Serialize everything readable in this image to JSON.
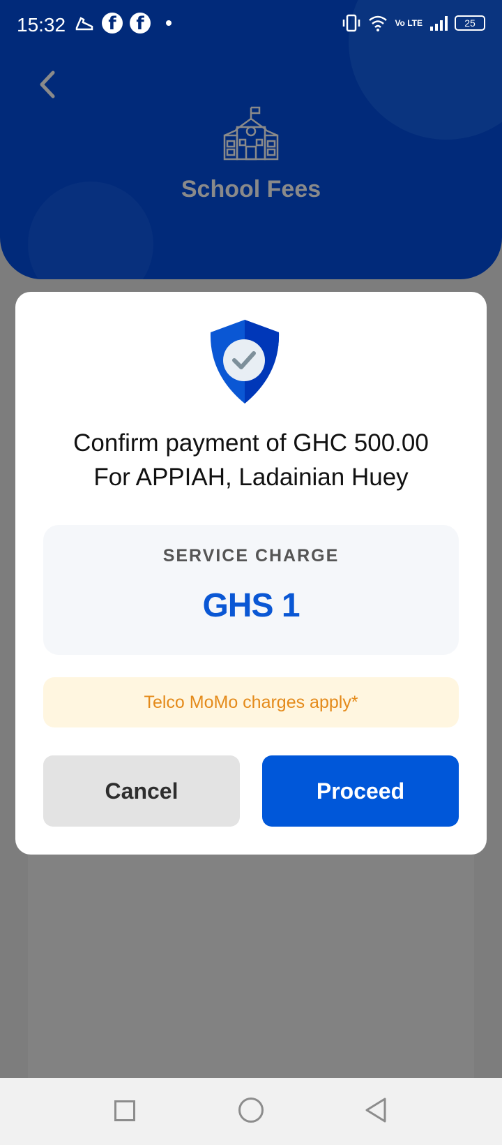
{
  "status_bar": {
    "time": "15:32",
    "battery": "25",
    "volte": "Vo LTE",
    "icons": [
      "shoe-icon",
      "facebook-icon",
      "facebook-icon",
      "dot-icon",
      "vibrate-icon",
      "wifi-icon",
      "signal-icon",
      "battery-icon"
    ]
  },
  "header": {
    "title": "School Fees",
    "icon": "school-icon",
    "color": "#012a7a"
  },
  "modal": {
    "icon": "shield-check-icon",
    "confirm_line1": "Confirm payment of GHC 500.00",
    "confirm_line2": "For APPIAH, Ladainian Huey",
    "service_charge_label": "SERVICE CHARGE",
    "service_charge_value": "GHS 1",
    "telco_note": "Telco MoMo charges apply*",
    "cancel_label": "Cancel",
    "proceed_label": "Proceed",
    "accent_color": "#0057d9"
  },
  "nav": {
    "icons": [
      "recent-apps-icon",
      "home-icon",
      "back-icon"
    ]
  }
}
